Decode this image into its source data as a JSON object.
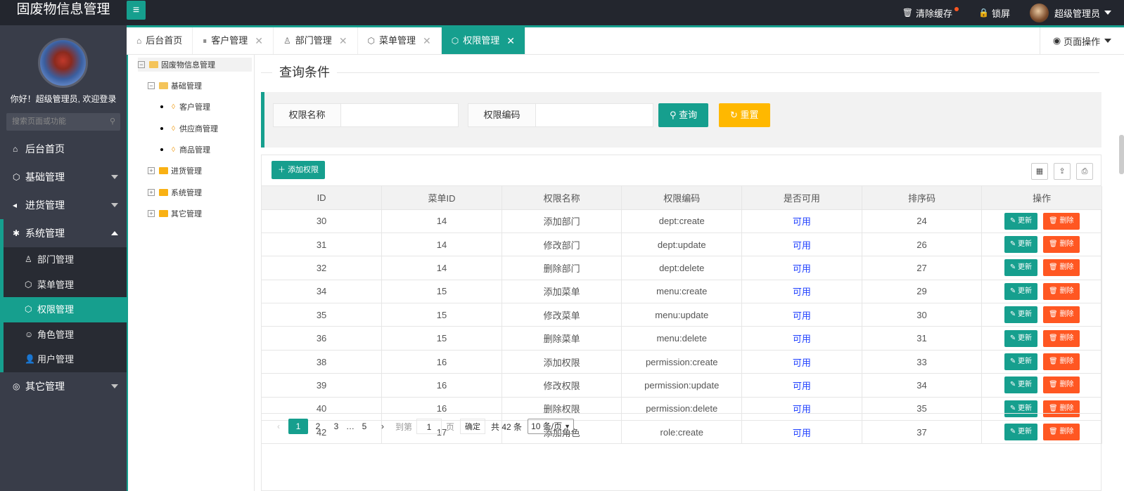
{
  "header": {
    "app_title": "固废物信息管理",
    "clear_cache": "清除缓存",
    "lock": "锁屏",
    "user": "超级管理员"
  },
  "sidebar": {
    "welcome": "你好！超级管理员, 欢迎登录",
    "search_placeholder": "搜索页面或功能",
    "items": [
      {
        "label": "后台首页"
      },
      {
        "label": "基础管理"
      },
      {
        "label": "进货管理"
      },
      {
        "label": "系统管理"
      },
      {
        "label": "其它管理"
      }
    ],
    "sub_items": [
      {
        "label": "部门管理"
      },
      {
        "label": "菜单管理"
      },
      {
        "label": "权限管理"
      },
      {
        "label": "角色管理"
      },
      {
        "label": "用户管理"
      }
    ]
  },
  "tabs": [
    {
      "label": "后台首页"
    },
    {
      "label": "客户管理"
    },
    {
      "label": "部门管理"
    },
    {
      "label": "菜单管理"
    },
    {
      "label": "权限管理"
    }
  ],
  "page_ops": "页面操作",
  "tree": {
    "root": "固废物信息管理",
    "basic": "基础管理",
    "customer": "客户管理",
    "supplier": "供应商管理",
    "goods": "商品管理",
    "purchase": "进货管理",
    "system": "系统管理",
    "other": "其它管理"
  },
  "query": {
    "section_title": "查询条件",
    "name_label": "权限名称",
    "code_label": "权限编码",
    "search_btn": "查询",
    "reset_btn": "重置"
  },
  "table": {
    "add_btn": "添加权限",
    "columns": [
      "ID",
      "菜单ID",
      "权限名称",
      "权限编码",
      "是否可用",
      "排序码",
      "操作"
    ],
    "update_label": "更新",
    "delete_label": "删除",
    "rows": [
      {
        "id": "30",
        "menu_id": "14",
        "name": "添加部门",
        "code": "dept:create",
        "avail": "可用",
        "order": "24"
      },
      {
        "id": "31",
        "menu_id": "14",
        "name": "修改部门",
        "code": "dept:update",
        "avail": "可用",
        "order": "26"
      },
      {
        "id": "32",
        "menu_id": "14",
        "name": "删除部门",
        "code": "dept:delete",
        "avail": "可用",
        "order": "27"
      },
      {
        "id": "34",
        "menu_id": "15",
        "name": "添加菜单",
        "code": "menu:create",
        "avail": "可用",
        "order": "29"
      },
      {
        "id": "35",
        "menu_id": "15",
        "name": "修改菜单",
        "code": "menu:update",
        "avail": "可用",
        "order": "30"
      },
      {
        "id": "36",
        "menu_id": "15",
        "name": "删除菜单",
        "code": "menu:delete",
        "avail": "可用",
        "order": "31"
      },
      {
        "id": "38",
        "menu_id": "16",
        "name": "添加权限",
        "code": "permission:create",
        "avail": "可用",
        "order": "33"
      },
      {
        "id": "39",
        "menu_id": "16",
        "name": "修改权限",
        "code": "permission:update",
        "avail": "可用",
        "order": "34"
      },
      {
        "id": "40",
        "menu_id": "16",
        "name": "删除权限",
        "code": "permission:delete",
        "avail": "可用",
        "order": "35"
      },
      {
        "id": "42",
        "menu_id": "17",
        "name": "添加角色",
        "code": "role:create",
        "avail": "可用",
        "order": "37"
      }
    ]
  },
  "pager": {
    "pages": [
      "1",
      "2",
      "3",
      "…",
      "5"
    ],
    "goto": "到第",
    "page_input": "1",
    "page_unit": "页",
    "confirm": "确定",
    "total": "共 42 条",
    "per_page": "10 条/页"
  },
  "colors": {
    "accent": "#169f8e",
    "danger": "#ff5722",
    "warn": "#ffb800",
    "sidebar": "#393d49",
    "header": "#23262e"
  }
}
